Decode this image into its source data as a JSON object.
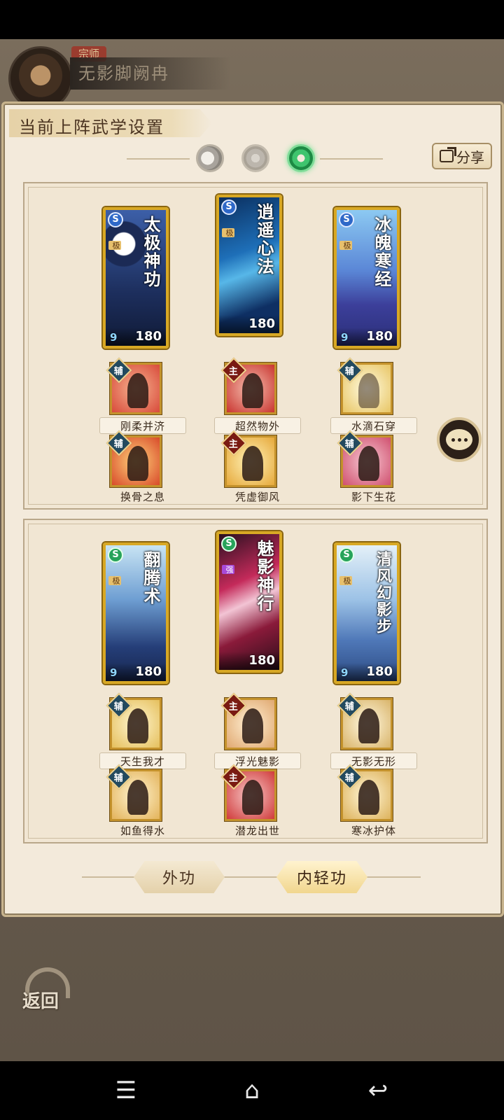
{
  "header": {
    "rank_badge": "宗师",
    "player_name": "无影脚阙冉"
  },
  "panel": {
    "title": "当前上阵武学设置",
    "share_label": "分享",
    "tabs": [
      {
        "label": "外功",
        "active": false
      },
      {
        "label": "内轻功",
        "active": true
      }
    ]
  },
  "groups": [
    {
      "cards": [
        {
          "name": "太极神功",
          "type_icon": "S",
          "grade": "极",
          "level": "9",
          "power": "180"
        },
        {
          "name": "逍遥心法",
          "type_icon": "S",
          "grade": "极",
          "level": "",
          "power": "180"
        },
        {
          "name": "冰魄寒经",
          "type_icon": "S",
          "grade": "极",
          "level": "9",
          "power": "180"
        }
      ],
      "skills": [
        {
          "name": "刚柔并济",
          "role": "辅"
        },
        {
          "name": "超然物外",
          "role": "主"
        },
        {
          "name": "水滴石穿",
          "role": "辅"
        },
        {
          "name": "换骨之息",
          "role": "辅"
        },
        {
          "name": "凭虚御风",
          "role": "主"
        },
        {
          "name": "影下生花",
          "role": "辅"
        }
      ]
    },
    {
      "cards": [
        {
          "name": "翻腾术",
          "type_icon": "S",
          "grade": "极",
          "level": "9",
          "power": "180"
        },
        {
          "name": "魅影神行",
          "type_icon": "S",
          "grade": "强",
          "level": "",
          "power": "180"
        },
        {
          "name": "清风幻影步",
          "type_icon": "S",
          "grade": "极",
          "level": "9",
          "power": "180"
        }
      ],
      "skills": [
        {
          "name": "天生我才",
          "role": "辅"
        },
        {
          "name": "浮光魅影",
          "role": "主"
        },
        {
          "name": "无影无形",
          "role": "辅"
        },
        {
          "name": "如鱼得水",
          "role": "辅"
        },
        {
          "name": "潜龙出世",
          "role": "主"
        },
        {
          "name": "寒冰护体",
          "role": "辅"
        }
      ]
    }
  ],
  "back_label": "返回",
  "nav": {
    "menu": "☰",
    "home": "⌂",
    "back": "↩"
  }
}
